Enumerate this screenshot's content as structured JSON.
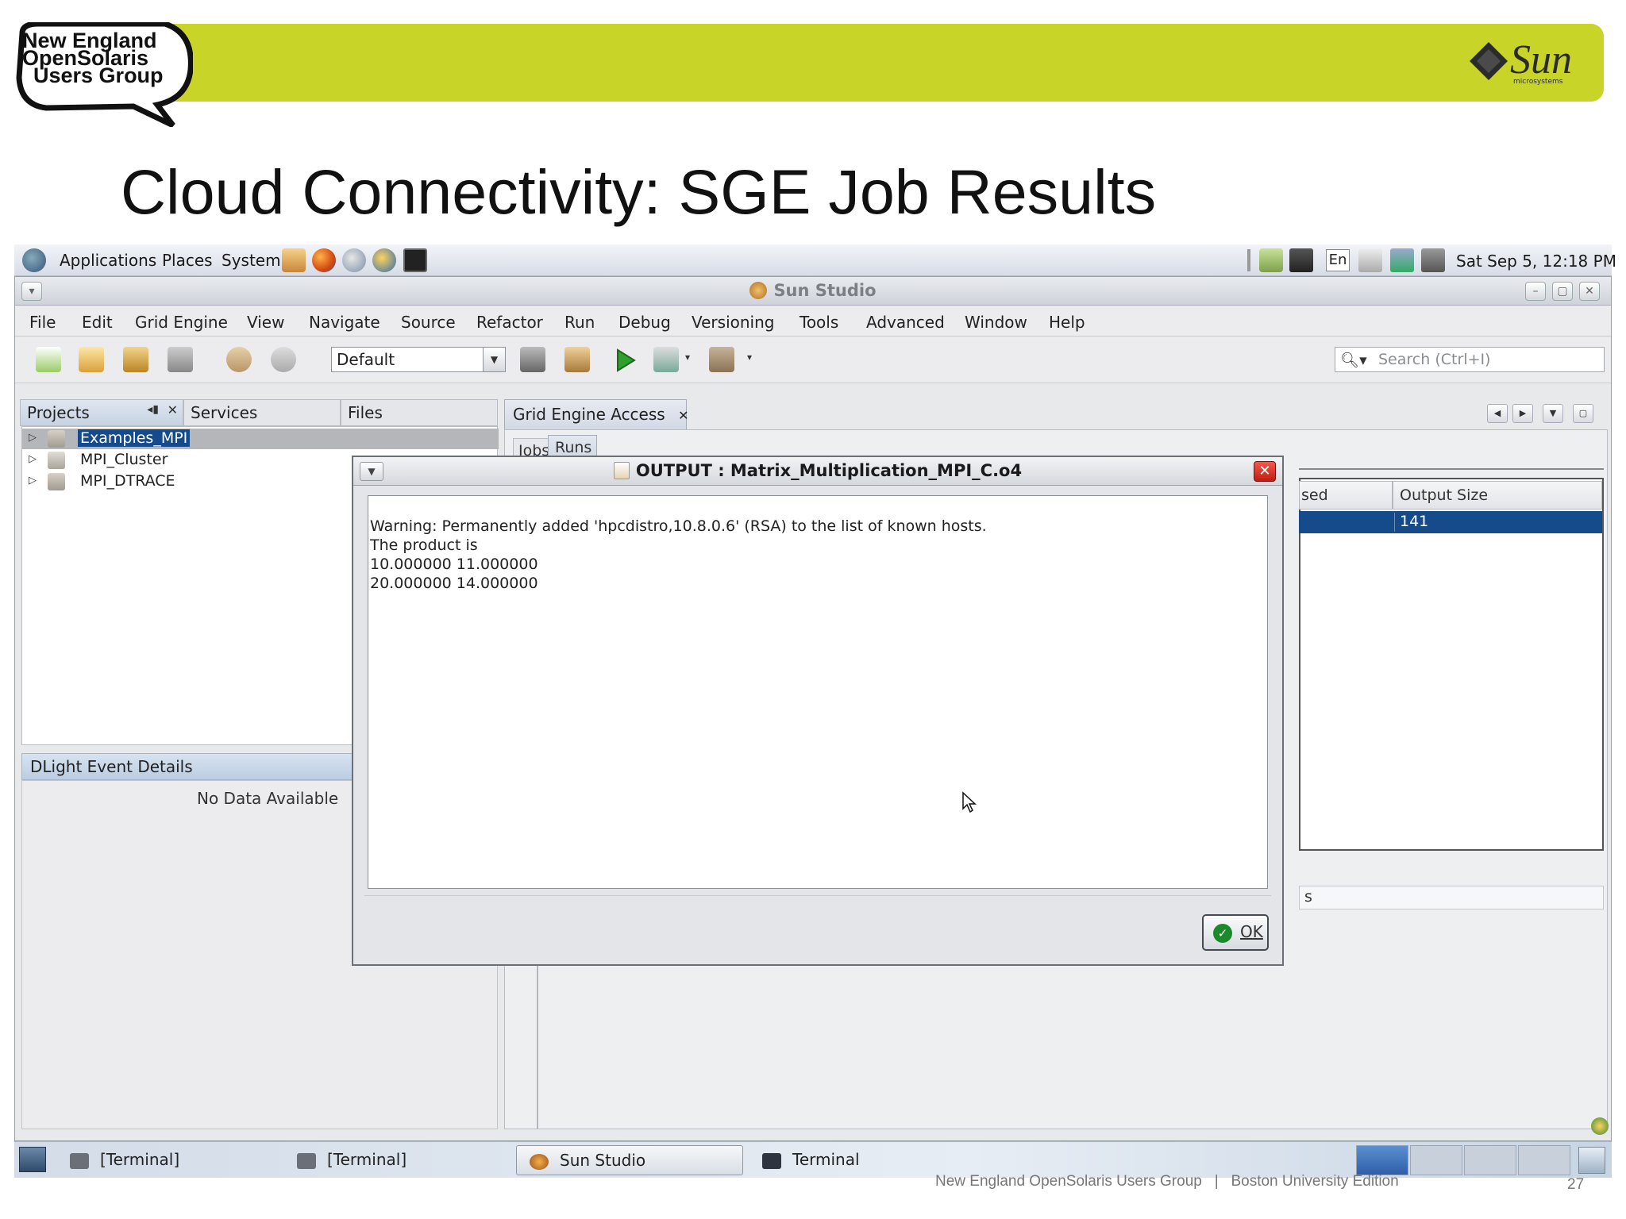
{
  "slide": {
    "bubble_lines": [
      "New England",
      "OpenSolaris",
      "Users Group"
    ],
    "title": "Cloud Connectivity: SGE Job Results",
    "footer_org": "New England OpenSolaris Users Group",
    "footer_sep": "|",
    "footer_edition": "Boston University Edition",
    "page_number": "27",
    "logo_text": "Sun",
    "logo_subtext": "microsystems",
    "banner_color": "#c8d428"
  },
  "panel": {
    "menus": [
      "Applications",
      "Places",
      "System"
    ],
    "input_method": "En",
    "clock": "Sat Sep  5, 12:18 PM"
  },
  "window": {
    "title": "Sun Studio",
    "menus": [
      "File",
      "Edit",
      "Grid Engine",
      "View",
      "Navigate",
      "Source",
      "Refactor",
      "Run",
      "Debug",
      "Versioning",
      "Tools",
      "Advanced",
      "Window",
      "Help"
    ],
    "config": "Default",
    "search_placeholder": "Search (Ctrl+I)"
  },
  "left": {
    "tabs": [
      "Projects",
      "Services",
      "Files"
    ],
    "projects": [
      "Examples_MPI",
      "MPI_Cluster",
      "MPI_DTRACE"
    ],
    "dlight_title": "DLight Event Details",
    "no_data": "No Data Available"
  },
  "right": {
    "tab": "Grid Engine Access",
    "subtabs": [
      "Jobs",
      "Runs"
    ],
    "col_partial": "sed",
    "col_output_size": "Output Size",
    "selected_output_size": "141",
    "lower_partial": "s",
    "selection_color": "#154b8a"
  },
  "dialog": {
    "title": "OUTPUT : Matrix_Multiplication_MPI_C.o4",
    "lines": [
      "Warning: Permanently added 'hpcdistro,10.8.0.6' (RSA) to the list of known hosts.",
      "The product is",
      "10.000000 11.000000",
      "20.000000 14.000000"
    ],
    "ok_label": "OK"
  },
  "taskbar": {
    "tasks": [
      "[Terminal]",
      "[Terminal]",
      "Sun Studio",
      "Terminal"
    ]
  }
}
